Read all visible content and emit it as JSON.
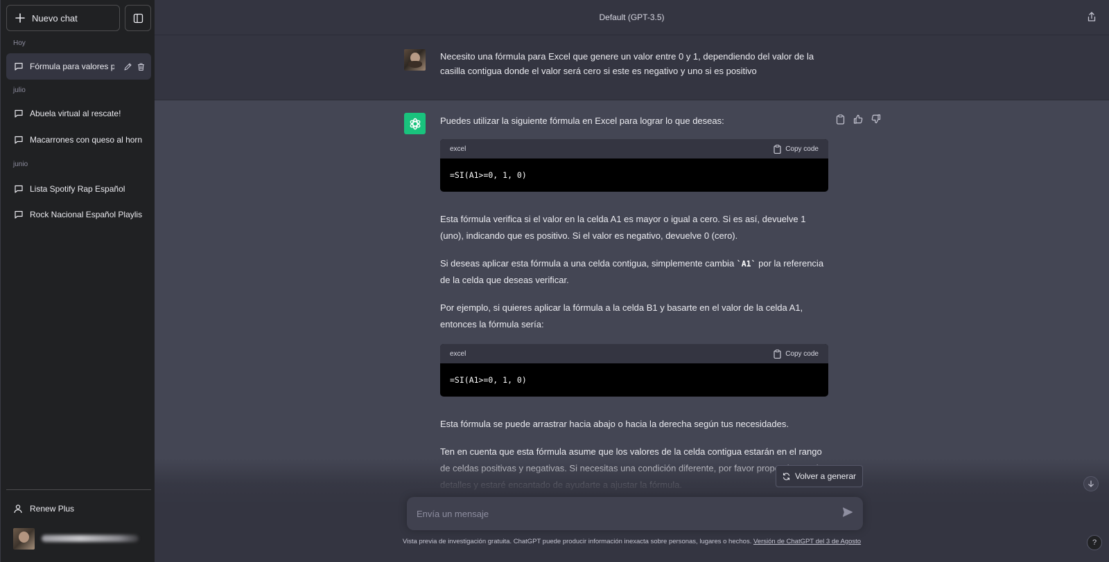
{
  "sidebar": {
    "new_chat_label": "Nuevo chat",
    "groups": [
      {
        "label": "Hoy",
        "items": [
          {
            "label": "Fórmula para valores p",
            "active": true
          }
        ]
      },
      {
        "label": "julio",
        "items": [
          {
            "label": "Abuela virtual al rescate!"
          },
          {
            "label": "Macarrones con queso al horno"
          }
        ]
      },
      {
        "label": "junio",
        "items": [
          {
            "label": "Lista Spotify Rap Español"
          },
          {
            "label": "Rock Nacional Español Playlist"
          }
        ]
      }
    ],
    "renew_label": "Renew Plus"
  },
  "header": {
    "model": "Default (GPT-3.5)"
  },
  "conversation": {
    "user_message": "Necesito una fórmula para Excel que genere un valor entre 0 y 1, dependiendo del valor de la casilla contigua donde el valor será cero si este es negativo y uno si es positivo",
    "assistant": {
      "intro": "Puedes utilizar la siguiente fórmula en Excel para lograr lo que deseas:",
      "code_block_1": {
        "language": "excel",
        "copy_label": "Copy code",
        "code": "=SI(A1>=0, 1, 0)"
      },
      "para_1": "Esta fórmula verifica si el valor en la celda A1 es mayor o igual a cero. Si es así, devuelve 1 (uno), indicando que es positivo. Si el valor es negativo, devuelve 0 (cero).",
      "para_2_before": "Si deseas aplicar esta fórmula a una celda contigua, simplemente cambia ",
      "para_2_code": "`A1`",
      "para_2_after": " por la referencia de la celda que deseas verificar.",
      "para_3": "Por ejemplo, si quieres aplicar la fórmula a la celda B1 y basarte en el valor de la celda A1, entonces la fórmula sería:",
      "code_block_2": {
        "language": "excel",
        "copy_label": "Copy code",
        "code": "=SI(A1>=0, 1, 0)"
      },
      "para_4": "Esta fórmula se puede arrastrar hacia abajo o hacia la derecha según tus necesidades.",
      "para_5": "Ten en cuenta que esta fórmula asume que los valores de la celda contigua estarán en el rango de celdas positivas y negativas. Si necesitas una condición diferente, por favor proporciona más detalles y estaré encantado de ayudarte a ajustar la fórmula."
    }
  },
  "composer": {
    "regenerate_label": "Volver a generar",
    "placeholder": "Envía un mensaje"
  },
  "footer": {
    "disclaimer": "Vista previa de investigación gratuita. ChatGPT puede producir información inexacta sobre personas, lugares o hechos. ",
    "version_link": "Versión de ChatGPT del 3 de Agosto",
    "help_label": "?"
  },
  "colors": {
    "sidebar_bg": "#202123",
    "main_bg": "#343541",
    "assistant_bg": "#444654",
    "gpt_green": "#19c37d"
  }
}
